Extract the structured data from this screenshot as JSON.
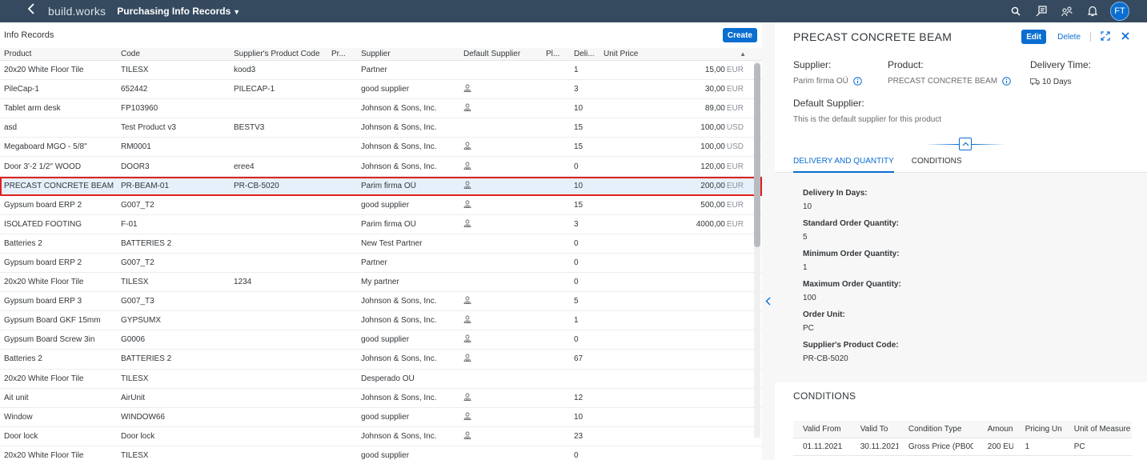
{
  "shell": {
    "brand": "build.works",
    "app_title": "Purchasing Info Records",
    "user_initials": "FT",
    "icons": [
      "search-icon",
      "tasks-icon",
      "people-icon",
      "bell-icon"
    ]
  },
  "table": {
    "title": "Info Records",
    "create_label": "Create",
    "columns": [
      "Product",
      "Code",
      "Supplier's Product Code",
      "Pr...",
      "Supplier",
      "Default Supplier",
      "Pl...",
      "Deli...",
      "Unit Price"
    ],
    "rows": [
      {
        "product": "20x20 White Floor Tile",
        "code": "TILESX",
        "spc": "kood3",
        "pr": "",
        "supplier": "Partner",
        "default": false,
        "pl": "",
        "delivery": "1",
        "price": "15,00",
        "currency": "EUR"
      },
      {
        "product": "PileCap-1",
        "code": "652442",
        "spc": "PILECAP-1",
        "pr": "",
        "supplier": "good supplier",
        "default": true,
        "pl": "",
        "delivery": "3",
        "price": "30,00",
        "currency": "EUR"
      },
      {
        "product": "Tablet arm desk",
        "code": "FP103960",
        "spc": "",
        "pr": "",
        "supplier": "Johnson & Sons, Inc.",
        "default": true,
        "pl": "",
        "delivery": "10",
        "price": "89,00",
        "currency": "EUR"
      },
      {
        "product": "asd",
        "code": "Test Product v3",
        "spc": "BESTV3",
        "pr": "",
        "supplier": "Johnson & Sons, Inc.",
        "default": false,
        "pl": "",
        "delivery": "15",
        "price": "100,00",
        "currency": "USD"
      },
      {
        "product": "Megaboard MGO - 5/8\"",
        "code": "RM0001",
        "spc": "",
        "pr": "",
        "supplier": "Johnson & Sons, Inc.",
        "default": true,
        "pl": "",
        "delivery": "15",
        "price": "100,00",
        "currency": "USD"
      },
      {
        "product": "Door 3'-2 1/2\" WOOD",
        "code": "DOOR3",
        "spc": "eree4",
        "pr": "",
        "supplier": "Johnson & Sons, Inc.",
        "default": true,
        "pl": "",
        "delivery": "0",
        "price": "120,00",
        "currency": "EUR"
      },
      {
        "product": "PRECAST CONCRETE BEAM",
        "code": "PR-BEAM-01",
        "spc": "PR-CB-5020",
        "pr": "",
        "supplier": "Parim firma OÜ",
        "default": true,
        "pl": "",
        "delivery": "10",
        "price": "200,00",
        "currency": "EUR",
        "selected": true
      },
      {
        "product": "Gypsum board ERP 2",
        "code": "G007_T2",
        "spc": "",
        "pr": "",
        "supplier": "good supplier",
        "default": true,
        "pl": "",
        "delivery": "15",
        "price": "500,00",
        "currency": "EUR"
      },
      {
        "product": "ISOLATED FOOTING",
        "code": "F-01",
        "spc": "",
        "pr": "",
        "supplier": "Parim firma OÜ",
        "default": true,
        "pl": "",
        "delivery": "3",
        "price": "4000,00",
        "currency": "EUR"
      },
      {
        "product": "Batteries 2",
        "code": "BATTERIES 2",
        "spc": "",
        "pr": "",
        "supplier": "New Test Partner",
        "default": false,
        "pl": "",
        "delivery": "0",
        "price": "",
        "currency": ""
      },
      {
        "product": "Gypsum board ERP 2",
        "code": "G007_T2",
        "spc": "",
        "pr": "",
        "supplier": "Partner",
        "default": false,
        "pl": "",
        "delivery": "0",
        "price": "",
        "currency": ""
      },
      {
        "product": "20x20 White Floor Tile",
        "code": "TILESX",
        "spc": "1234",
        "pr": "",
        "supplier": "My partner",
        "default": false,
        "pl": "",
        "delivery": "0",
        "price": "",
        "currency": ""
      },
      {
        "product": "Gypsum board ERP 3",
        "code": "G007_T3",
        "spc": "",
        "pr": "",
        "supplier": "Johnson & Sons, Inc.",
        "default": true,
        "pl": "",
        "delivery": "5",
        "price": "",
        "currency": ""
      },
      {
        "product": "Gypsum Board GKF 15mm",
        "code": "GYPSUMX",
        "spc": "",
        "pr": "",
        "supplier": "Johnson & Sons, Inc.",
        "default": true,
        "pl": "",
        "delivery": "1",
        "price": "",
        "currency": ""
      },
      {
        "product": "Gypsum Board Screw 3in",
        "code": "G0006",
        "spc": "",
        "pr": "",
        "supplier": "good supplier",
        "default": true,
        "pl": "",
        "delivery": "0",
        "price": "",
        "currency": ""
      },
      {
        "product": "Batteries 2",
        "code": "BATTERIES 2",
        "spc": "",
        "pr": "",
        "supplier": "Johnson & Sons, Inc.",
        "default": true,
        "pl": "",
        "delivery": "67",
        "price": "",
        "currency": ""
      },
      {
        "product": "20x20 White Floor Tile",
        "code": "TILESX",
        "spc": "",
        "pr": "",
        "supplier": "Desperado OÜ",
        "default": false,
        "pl": "",
        "delivery": "",
        "price": "",
        "currency": ""
      },
      {
        "product": "Ait unit",
        "code": "AirUnit",
        "spc": "",
        "pr": "",
        "supplier": "Johnson & Sons, Inc.",
        "default": true,
        "pl": "",
        "delivery": "12",
        "price": "",
        "currency": ""
      },
      {
        "product": "Window",
        "code": "WINDOW66",
        "spc": "",
        "pr": "",
        "supplier": "good supplier",
        "default": true,
        "pl": "",
        "delivery": "10",
        "price": "",
        "currency": ""
      },
      {
        "product": "Door lock",
        "code": "Door lock",
        "spc": "",
        "pr": "",
        "supplier": "Johnson & Sons, Inc.",
        "default": true,
        "pl": "",
        "delivery": "23",
        "price": "",
        "currency": ""
      },
      {
        "product": "20x20 White Floor Tile",
        "code": "TILESX",
        "spc": "",
        "pr": "",
        "supplier": "good supplier",
        "default": false,
        "pl": "",
        "delivery": "0",
        "price": "",
        "currency": ""
      }
    ]
  },
  "detail": {
    "title": "PRECAST CONCRETE BEAM",
    "edit_label": "Edit",
    "delete_label": "Delete",
    "supplier_label": "Supplier:",
    "supplier_value": "Parim firma OÜ",
    "product_label": "Product:",
    "product_value": "PRECAST CONCRETE BEAM",
    "delivery_time_label": "Delivery Time:",
    "delivery_time_value": "10 Days",
    "default_supplier_label": "Default Supplier:",
    "default_supplier_value": "This is the default supplier for this product",
    "tabs": [
      "DELIVERY AND QUANTITY",
      "CONDITIONS"
    ],
    "fields": [
      {
        "label": "Delivery In Days:",
        "value": "10"
      },
      {
        "label": "Standard Order Quantity:",
        "value": "5"
      },
      {
        "label": "Minimum Order Quantity:",
        "value": "1"
      },
      {
        "label": "Maximum Order Quantity:",
        "value": "100"
      },
      {
        "label": "Order Unit:",
        "value": "PC"
      },
      {
        "label": "Supplier's Product Code:",
        "value": "PR-CB-5020"
      }
    ],
    "conditions": {
      "title": "CONDITIONS",
      "columns": [
        "Valid From",
        "Valid To",
        "Condition Type",
        "Amount",
        "Pricing Unit",
        "Unit of Measure"
      ],
      "rows": [
        [
          "01.11.2021",
          "30.11.2021",
          "Gross Price (PB00)",
          "200 EUR",
          "1",
          "PC"
        ]
      ]
    }
  },
  "colors": {
    "shell_bg": "#354a5f",
    "accent": "#0a6ed1",
    "selection_outline": "#e02020",
    "selection_bg": "#e5f0fa"
  }
}
